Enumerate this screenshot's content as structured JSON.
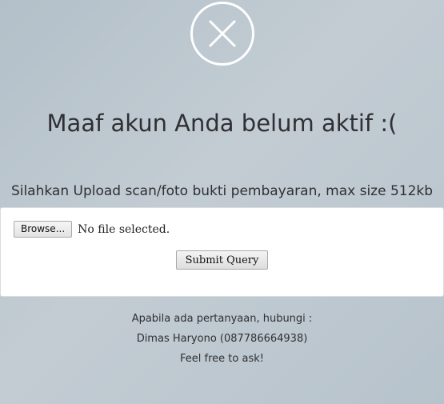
{
  "status_icon": "close-circle-icon",
  "title": "Maaf akun Anda belum aktif :(",
  "instruction": "Silahkan Upload scan/foto bukti pembayaran, max size 512kb",
  "upload": {
    "browse_label": "Browse...",
    "file_status": "No file selected.",
    "submit_label": "Submit Query"
  },
  "contact": {
    "line1": "Apabila ada pertanyaan, hubungi :",
    "line2": "Dimas Haryono (087786664938)",
    "line3": "Feel free to ask!"
  },
  "colors": {
    "background": "#bac5cd",
    "text": "#2f3033",
    "panel": "#ffffff"
  }
}
